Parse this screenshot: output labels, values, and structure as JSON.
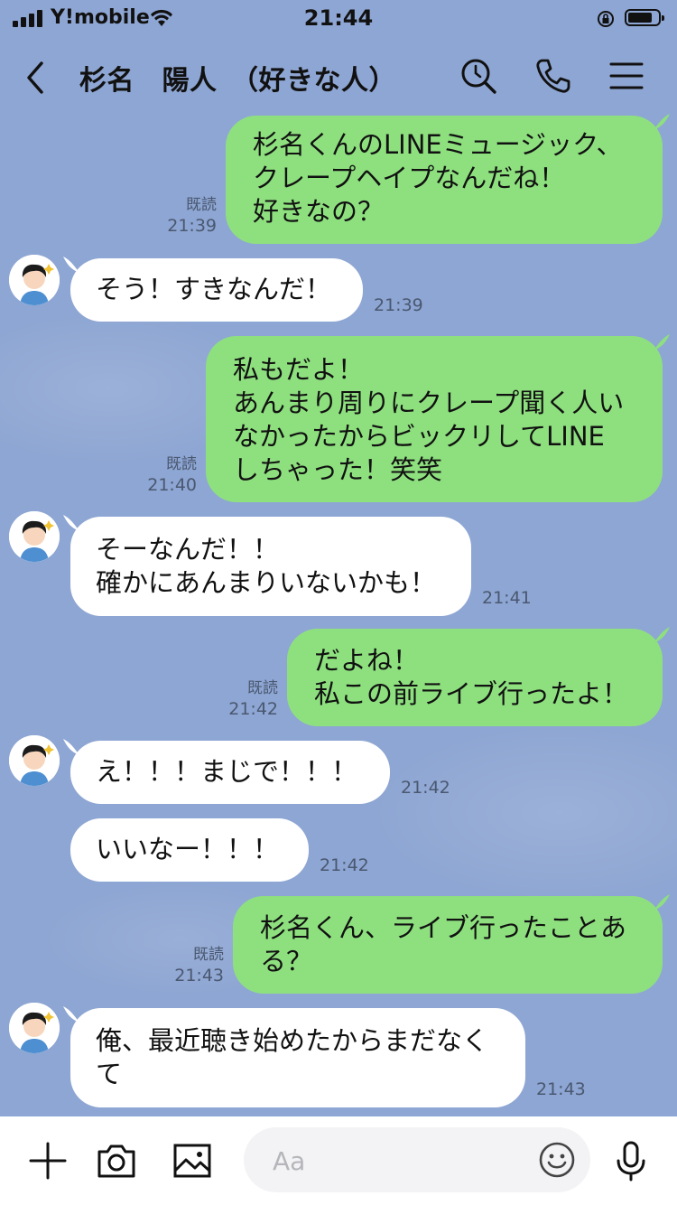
{
  "status_bar": {
    "carrier": "Y!mobile",
    "time": "21:44"
  },
  "header": {
    "title": "杉名　陽人　（好きな人）"
  },
  "messages": [
    {
      "from": "me",
      "text": "杉名くんのLINEミュージック、\nクレープヘイプなんだね！\n好きなの？",
      "read": "既読",
      "time": "21:39"
    },
    {
      "from": "them",
      "text": "そう！すきなんだ！",
      "time": "21:39"
    },
    {
      "from": "me",
      "text": "私もだよ！\nあんまり周りにクレープ聞く人い\nなかったからビックリしてLINE\nしちゃった！笑笑",
      "read": "既読",
      "time": "21:40"
    },
    {
      "from": "them",
      "text": "そーなんだ！！\n確かにあんまりいないかも！",
      "time": "21:41"
    },
    {
      "from": "me",
      "text": "だよね！\n私この前ライブ行ったよ！",
      "read": "既読",
      "time": "21:42"
    },
    {
      "from": "them",
      "text": "え！！！まじで！！！",
      "time": "21:42"
    },
    {
      "from": "them",
      "text": "いいなー！！！",
      "time": "21:42"
    },
    {
      "from": "me",
      "text": "杉名くん、ライブ行ったことあ\nる？",
      "read": "既読",
      "time": "21:43"
    },
    {
      "from": "them",
      "text": "俺、最近聴き始めたからまだなく\nて",
      "time": "21:43"
    }
  ],
  "input": {
    "placeholder": "Aa"
  },
  "colors": {
    "background": "#8ea6d3",
    "outgoing_bubble": "#8ee07f",
    "incoming_bubble": "#ffffff"
  },
  "icons": [
    "back-chevron-icon",
    "search-icon",
    "phone-icon",
    "menu-icon",
    "plus-icon",
    "camera-icon",
    "image-icon",
    "emoji-icon",
    "microphone-icon"
  ]
}
